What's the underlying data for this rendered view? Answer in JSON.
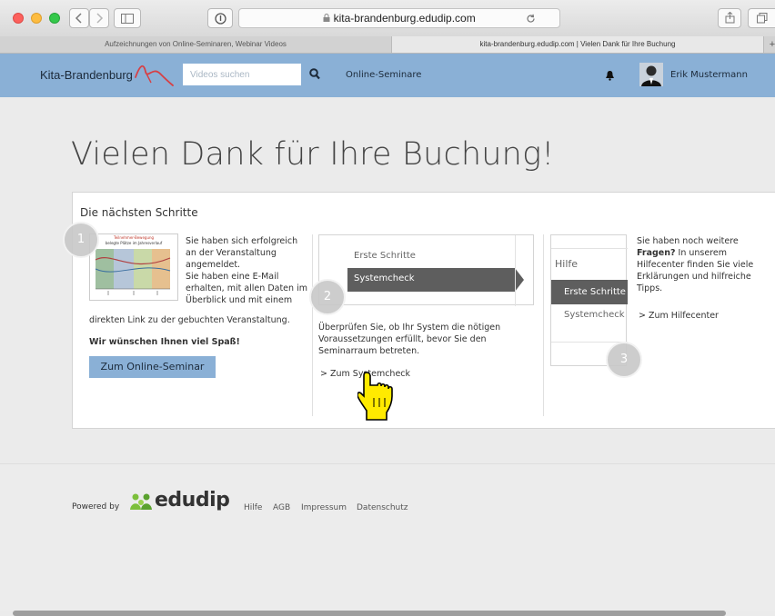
{
  "browser": {
    "url": "kita-brandenburg.edudip.com",
    "tabs": [
      {
        "label": "Aufzeichnungen von Online-Seminaren, Webinar Videos"
      },
      {
        "label": "kita-brandenburg.edudip.com | Vielen Dank für Ihre Buchung"
      },
      {
        "label": "+"
      }
    ]
  },
  "header": {
    "brand": "Kita-Brandenburg",
    "search_placeholder": "Videos suchen",
    "nav_link": "Online-Seminare",
    "user_name": "Erik Mustermann"
  },
  "main": {
    "title": "Vielen Dank für Ihre Buchung!",
    "card_title": "Die nächsten Schritte",
    "step1": {
      "number": "1",
      "text_lines": [
        "Sie haben sich erfolgreich",
        "an der Veranstaltung",
        "angemeldet.",
        "Sie haben eine E-Mail",
        "erhalten, mit allen Daten im",
        "Überblick und mit einem"
      ],
      "text_full": "direkten Link zu der gebuchten Veranstaltung.",
      "wish": "Wir wünschen Ihnen viel Spaß!",
      "button": "Zum Online-Seminar",
      "chart_title": "Teilnehmer-Bewegung",
      "chart_subtitle": "belegte Plätze im Jahresverlauf"
    },
    "step2": {
      "number": "2",
      "menu": [
        "Erste Schritte",
        "Systemcheck"
      ],
      "text_lines": [
        "Überprüfen Sie, ob Ihr System die nötigen",
        "Voraussetzungen erfüllt, bevor Sie den",
        "Seminarraum betreten."
      ],
      "link": "> Zum Systemcheck"
    },
    "step3": {
      "number": "3",
      "menu_title": "Hilfe",
      "menu": [
        "Erste Schritte",
        "Systemcheck"
      ],
      "text_prefix": "Sie haben noch weitere",
      "text_bold": "Fragen?",
      "text_rest": " In unserem",
      "text_lines": [
        "Hilfecenter finden Sie viele",
        "Erklärungen und hilfreiche",
        "Tipps."
      ],
      "link": "> Zum Hilfecenter"
    }
  },
  "footer": {
    "powered_by": "Powered by",
    "logo_text": "edudip",
    "links": [
      "Hilfe",
      "AGB",
      "Impressum",
      "Datenschutz"
    ]
  },
  "colors": {
    "accent": "#8ab0d6",
    "menu_active": "#5e5e5e"
  }
}
